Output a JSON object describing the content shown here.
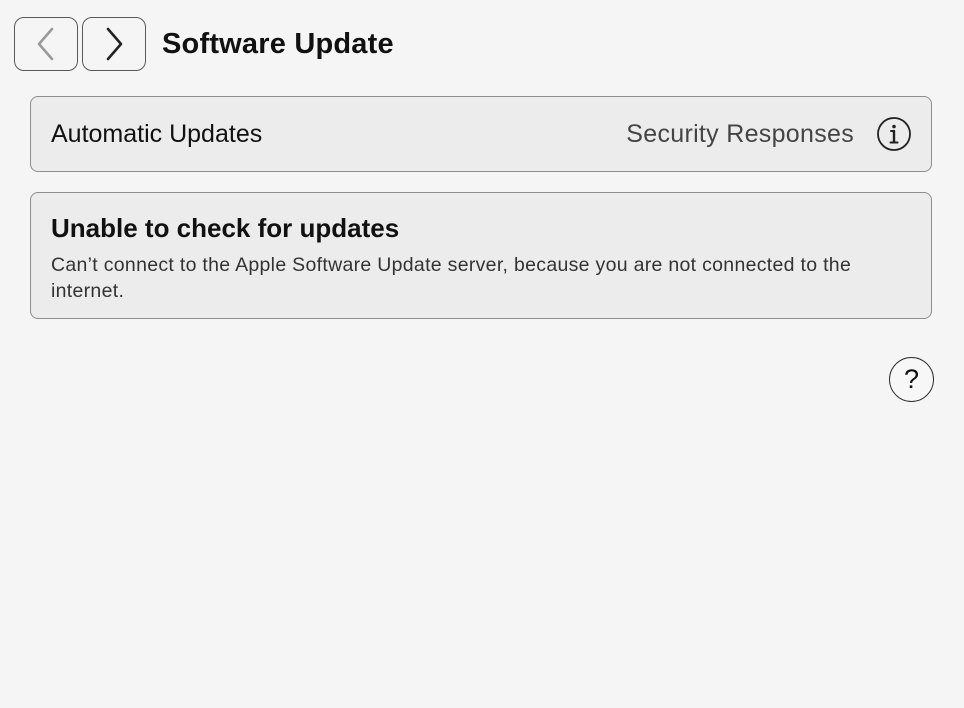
{
  "header": {
    "title": "Software Update",
    "back_icon": "chevron-left-icon",
    "forward_icon": "chevron-right-icon"
  },
  "automatic_updates": {
    "label": "Automatic Updates",
    "value": "Security Responses",
    "info_icon": "info-icon"
  },
  "status": {
    "title": "Unable to check for updates",
    "description": "Can’t connect to the Apple Software Update server, because you are not connected to the internet."
  },
  "help": {
    "label": "?",
    "icon": "help-icon"
  },
  "colors": {
    "background": "#f5f5f5",
    "card_background": "#ececec",
    "card_border": "#8e8e8e",
    "back_disabled": "#9a9a9a"
  }
}
